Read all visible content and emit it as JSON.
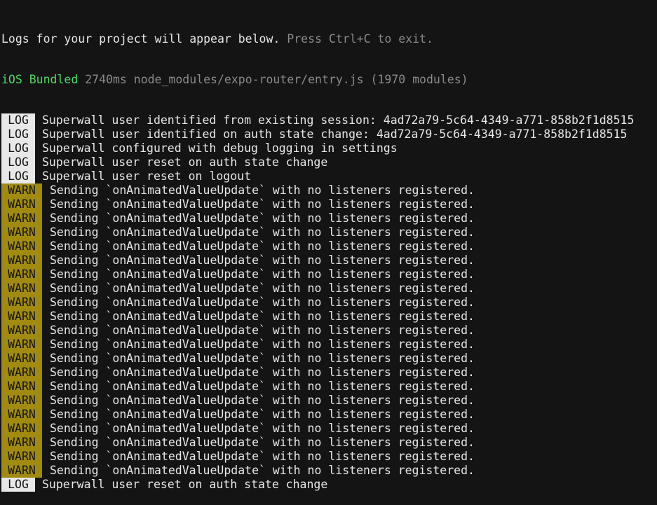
{
  "header": {
    "logs_text": "Logs for your project will appear below.",
    "exit_hint": "Press Ctrl+C to exit."
  },
  "bundle": {
    "platform_status": "iOS Bundled",
    "details": "2740ms node_modules/expo-router/entry.js (1970 modules)"
  },
  "entries": [
    {
      "level": "LOG",
      "message": "Superwall user identified from existing session: 4ad72a79-5c64-4349-a771-858b2f1d8515"
    },
    {
      "level": "LOG",
      "message": "Superwall user identified on auth state change: 4ad72a79-5c64-4349-a771-858b2f1d8515"
    },
    {
      "level": "LOG",
      "message": "Superwall configured with debug logging in settings"
    },
    {
      "level": "LOG",
      "message": "Superwall user reset on auth state change"
    },
    {
      "level": "LOG",
      "message": "Superwall user reset on logout"
    },
    {
      "level": "WARN",
      "message": "Sending `onAnimatedValueUpdate` with no listeners registered."
    },
    {
      "level": "WARN",
      "message": "Sending `onAnimatedValueUpdate` with no listeners registered."
    },
    {
      "level": "WARN",
      "message": "Sending `onAnimatedValueUpdate` with no listeners registered."
    },
    {
      "level": "WARN",
      "message": "Sending `onAnimatedValueUpdate` with no listeners registered."
    },
    {
      "level": "WARN",
      "message": "Sending `onAnimatedValueUpdate` with no listeners registered."
    },
    {
      "level": "WARN",
      "message": "Sending `onAnimatedValueUpdate` with no listeners registered."
    },
    {
      "level": "WARN",
      "message": "Sending `onAnimatedValueUpdate` with no listeners registered."
    },
    {
      "level": "WARN",
      "message": "Sending `onAnimatedValueUpdate` with no listeners registered."
    },
    {
      "level": "WARN",
      "message": "Sending `onAnimatedValueUpdate` with no listeners registered."
    },
    {
      "level": "WARN",
      "message": "Sending `onAnimatedValueUpdate` with no listeners registered."
    },
    {
      "level": "WARN",
      "message": "Sending `onAnimatedValueUpdate` with no listeners registered."
    },
    {
      "level": "WARN",
      "message": "Sending `onAnimatedValueUpdate` with no listeners registered."
    },
    {
      "level": "WARN",
      "message": "Sending `onAnimatedValueUpdate` with no listeners registered."
    },
    {
      "level": "WARN",
      "message": "Sending `onAnimatedValueUpdate` with no listeners registered."
    },
    {
      "level": "WARN",
      "message": "Sending `onAnimatedValueUpdate` with no listeners registered."
    },
    {
      "level": "WARN",
      "message": "Sending `onAnimatedValueUpdate` with no listeners registered."
    },
    {
      "level": "WARN",
      "message": "Sending `onAnimatedValueUpdate` with no listeners registered."
    },
    {
      "level": "WARN",
      "message": "Sending `onAnimatedValueUpdate` with no listeners registered."
    },
    {
      "level": "WARN",
      "message": "Sending `onAnimatedValueUpdate` with no listeners registered."
    },
    {
      "level": "WARN",
      "message": "Sending `onAnimatedValueUpdate` with no listeners registered."
    },
    {
      "level": "WARN",
      "message": "Sending `onAnimatedValueUpdate` with no listeners registered."
    },
    {
      "level": "LOG",
      "message": "Superwall user reset on auth state change"
    }
  ],
  "colors": {
    "background": "#141414",
    "text": "#e8e8e8",
    "dim": "#8a8a8a",
    "bundled_green": "#4fd66b",
    "warn_badge": "#a08a10",
    "log_badge": "#e8e8e8"
  }
}
